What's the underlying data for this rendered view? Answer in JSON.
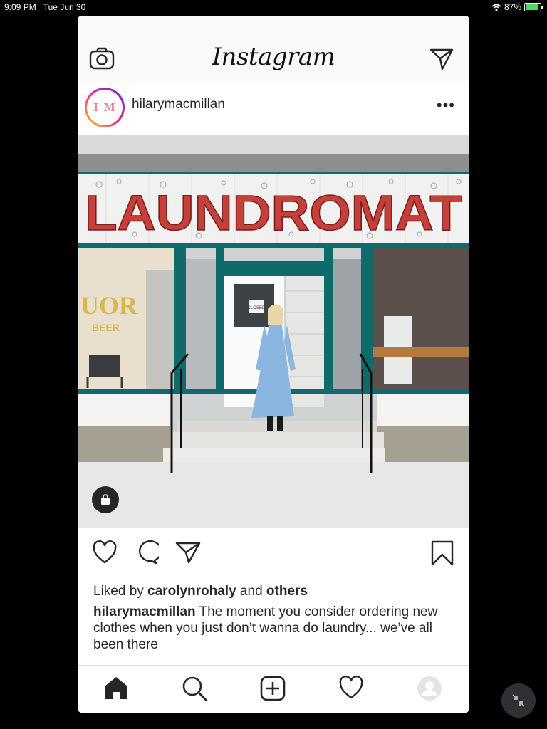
{
  "status_bar": {
    "time": "9:09 PM",
    "date": "Tue Jun 30",
    "battery": "87%",
    "battery_level": 0.87
  },
  "header": {
    "logo": "Instagram",
    "icons": [
      "camera-icon",
      "direct-message-icon"
    ]
  },
  "post": {
    "username": "hilarymacmillan",
    "avatar_text": "I M",
    "more": "•••",
    "photo": {
      "sign": "LAUNDROMAT",
      "door_sign": "CLOSED",
      "window_text_1": "UOR",
      "window_text_2": "BEER"
    },
    "likes": {
      "prefix": "Liked by ",
      "user": "carolynrohaly",
      "middle": " and ",
      "others": "others"
    },
    "caption": {
      "author": "hilarymacmillan",
      "text": " The moment you consider ordering new clothes when you just don’t wanna do laundry... we’ve all been there"
    }
  },
  "tab_bar": {
    "tabs": [
      "home-icon",
      "search-icon",
      "new-post-icon",
      "activity-icon",
      "profile-icon"
    ]
  },
  "colors": {
    "trim": "#0f6b6b",
    "sign_letters": "#c5403a",
    "coat": "#8ab6e0"
  }
}
